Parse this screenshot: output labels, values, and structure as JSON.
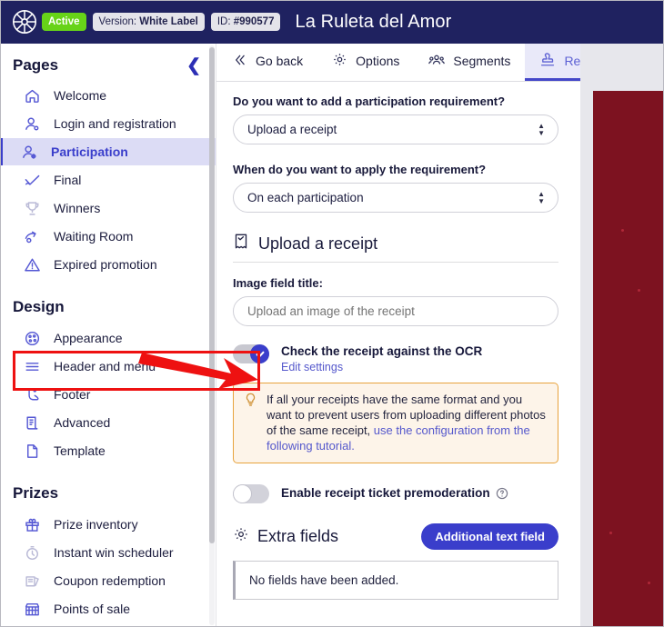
{
  "topbar": {
    "logo_icon": "roulette-wheel-icon",
    "status_badge": "Active",
    "version_prefix": "Version: ",
    "version_value": "White Label",
    "id_prefix": "ID: ",
    "id_value": "#990577",
    "promo_title": "La Ruleta del Amor",
    "bg_color": "#1f2260",
    "status_color": "#67d318"
  },
  "sidebar": {
    "title": "Pages",
    "collapse_icon": "chevron-left-icon",
    "pages": [
      {
        "label": "Welcome",
        "icon": "home-icon",
        "active": false,
        "dim": false
      },
      {
        "label": "Login and registration",
        "icon": "user-key-icon",
        "active": false,
        "dim": false
      },
      {
        "label": "Participation",
        "icon": "user-check-icon",
        "active": true,
        "dim": false
      },
      {
        "label": "Final",
        "icon": "check-wave-icon",
        "active": false,
        "dim": false
      },
      {
        "label": "Winners",
        "icon": "trophy-icon",
        "active": false,
        "dim": true
      },
      {
        "label": "Waiting Room",
        "icon": "waiting-room-icon",
        "active": false,
        "dim": false
      },
      {
        "label": "Expired promotion",
        "icon": "warning-triangle-icon",
        "active": false,
        "dim": false
      }
    ],
    "design_title": "Design",
    "design": [
      {
        "label": "Appearance",
        "icon": "palette-icon",
        "active": false,
        "dim": false
      },
      {
        "label": "Header and menu",
        "icon": "menu-lines-icon",
        "active": false,
        "dim": false
      },
      {
        "label": "Footer",
        "icon": "footer-boot-icon",
        "active": false,
        "dim": false
      },
      {
        "label": "Advanced",
        "icon": "scroll-document-icon",
        "active": false,
        "dim": false
      },
      {
        "label": "Template",
        "icon": "page-icon",
        "active": false,
        "dim": false
      }
    ],
    "prizes_title": "Prizes",
    "prizes": [
      {
        "label": "Prize inventory",
        "icon": "gift-icon",
        "active": false,
        "dim": false
      },
      {
        "label": "Instant win scheduler",
        "icon": "stopwatch-icon",
        "active": false,
        "dim": true
      },
      {
        "label": "Coupon redemption",
        "icon": "coupon-icon",
        "active": false,
        "dim": true
      },
      {
        "label": "Points of sale",
        "icon": "store-icon",
        "active": false,
        "dim": false
      }
    ],
    "accent_color": "#3a3ecb",
    "active_bg": "#dcdcf5"
  },
  "tabs": [
    {
      "label": "Go back",
      "icon": "double-chevron-left-icon",
      "active": false
    },
    {
      "label": "Options",
      "icon": "gear-icon",
      "active": false
    },
    {
      "label": "Segments",
      "icon": "people-group-icon",
      "active": false
    },
    {
      "label": "Requirements",
      "icon": "stamp-icon",
      "active": true
    }
  ],
  "form": {
    "requirement_question": "Do you want to add a participation requirement?",
    "requirement_value": "Upload a receipt",
    "apply_question": "When do you want to apply the requirement?",
    "apply_value": "On each participation",
    "section_title": "Upload a receipt",
    "section_icon": "receipt-icon",
    "image_field_label": "Image field title:",
    "image_field_placeholder": "Upload an image of the receipt",
    "image_field_value": "",
    "ocr_toggle_label": "Check the receipt against the OCR",
    "ocr_toggle_state": "on",
    "ocr_edit_link": "Edit settings",
    "tip_icon": "lightbulb-icon",
    "tip_text_part1": "If all your receipts have the same format and you want to prevent users from uploading different photos of the same receipt, ",
    "tip_link_text": "use the configuration from the following tutorial.",
    "premoderation_label": "Enable receipt ticket premoderation",
    "premoderation_state": "off",
    "premoderation_help_icon": "question-circle-icon",
    "extra_fields_title": "Extra fields",
    "extra_fields_icon": "gear-icon",
    "additional_text_field_button": "Additional text field",
    "empty_fields_message": "No fields have been added.",
    "tip_border_color": "#e8a33d",
    "tip_bg_color": "#fdf4e9",
    "highlight_color": "#ee1111"
  },
  "preview": {
    "background_color": "#7d1220",
    "name": "promotion-preview-panel"
  },
  "annotation": {
    "arrow_color": "#ee1111",
    "arrow_name": "red-pointer-arrow",
    "target": "ocr-toggle"
  }
}
